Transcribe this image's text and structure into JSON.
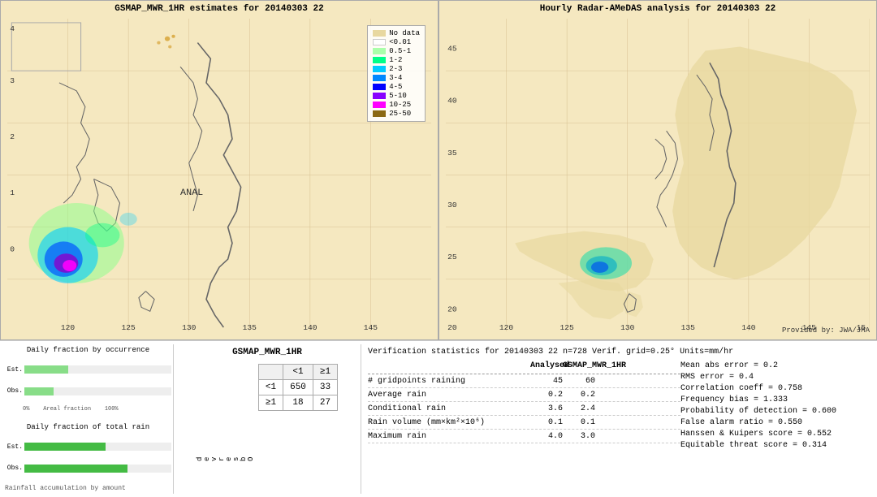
{
  "left_map": {
    "title": "GSMAP_MWR_1HR estimates for 20140303 22",
    "anal_label": "ANAL"
  },
  "right_map": {
    "title": "Hourly Radar-AMeDAS analysis for 20140303 22",
    "provided_by": "Provided by: JWA/JMA",
    "y_labels": [
      "45",
      "40",
      "35",
      "30",
      "25",
      "20"
    ],
    "x_labels": [
      "120",
      "125",
      "130",
      "135",
      "140",
      "145",
      "15"
    ]
  },
  "legend": {
    "title": "",
    "items": [
      {
        "label": "No data",
        "color": "#e8d8a0"
      },
      {
        "label": "<0.01",
        "color": "#ffffff"
      },
      {
        "label": "0.5-1",
        "color": "#aaffaa"
      },
      {
        "label": "1-2",
        "color": "#00ff88"
      },
      {
        "label": "2-3",
        "color": "#00ccff"
      },
      {
        "label": "3-4",
        "color": "#0088ff"
      },
      {
        "label": "4-5",
        "color": "#0000ff"
      },
      {
        "label": "5-10",
        "color": "#8800ff"
      },
      {
        "label": "10-25",
        "color": "#ff00ff"
      },
      {
        "label": "25-50",
        "color": "#8B6914"
      }
    ]
  },
  "charts": {
    "title1": "Daily fraction by occurrence",
    "est_label": "Est.",
    "obs_label": "Obs.",
    "x_axis_label": "0%        Areal fraction       100%",
    "title2": "Daily fraction of total rain",
    "est_label2": "Est.",
    "obs_label2": "Obs.",
    "rainfall_label": "Rainfall accumulation by amount"
  },
  "contingency": {
    "title": "GSMAP_MWR_1HR",
    "col_lt1": "<1",
    "col_ge1": "≥1",
    "row_lt1": "<1",
    "row_ge1": "≥1",
    "observed_label": "O b s e r v e d",
    "val_lt1_lt1": "650",
    "val_lt1_ge1": "33",
    "val_ge1_lt1": "18",
    "val_ge1_ge1": "27"
  },
  "verification": {
    "title": "Verification statistics for 20140303 22   n=728   Verif. grid=0.25°   Units=mm/hr",
    "header_analysed": "Analysed",
    "header_gsmap": "GSMAP_MWR_1HR",
    "rows": [
      {
        "metric": "# gridpoints raining",
        "val1": "45",
        "val2": "60"
      },
      {
        "metric": "Average rain",
        "val1": "0.2",
        "val2": "0.2"
      },
      {
        "metric": "Conditional rain",
        "val1": "3.6",
        "val2": "2.4"
      },
      {
        "metric": "Rain volume (mm×km²×10⁶)",
        "val1": "0.1",
        "val2": "0.1"
      },
      {
        "metric": "Maximum rain",
        "val1": "4.0",
        "val2": "3.0"
      }
    ],
    "right_stats": [
      "Mean abs error = 0.2",
      "RMS error = 0.4",
      "Correlation coeff = 0.758",
      "Frequency bias = 1.333",
      "Probability of detection = 0.600",
      "False alarm ratio = 0.550",
      "Hanssen & Kuipers score = 0.552",
      "Equitable threat score = 0.314"
    ]
  }
}
